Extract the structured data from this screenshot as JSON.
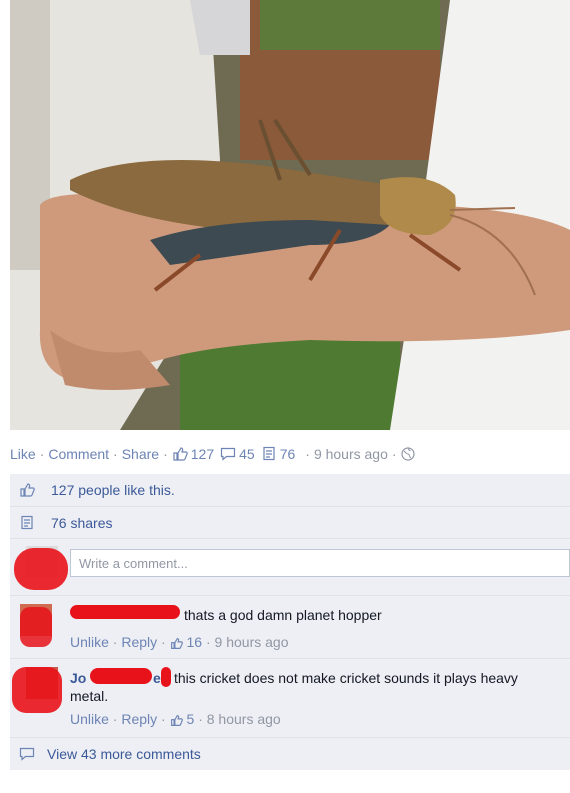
{
  "post": {
    "actions": {
      "like": "Like",
      "comment": "Comment",
      "share": "Share",
      "sep": "·"
    },
    "counts": {
      "likes": "127",
      "comments": "45",
      "shares": "76"
    },
    "time": "9 hours ago",
    "likes_summary": "127 people like this.",
    "shares_summary": "76 shares"
  },
  "composer": {
    "placeholder": "Write a comment..."
  },
  "comments": [
    {
      "name": "",
      "text": "thats a god damn planet hopper",
      "unlike": "Unlike",
      "reply": "Reply",
      "likes": "16",
      "time": "9 hours ago"
    },
    {
      "name": "Jo",
      "name_tail": "e",
      "text": "this cricket does not make cricket sounds it plays heavy",
      "text2": "metal.",
      "unlike": "Unlike",
      "reply": "Reply",
      "likes": "5",
      "time": "8 hours ago"
    }
  ],
  "more_comments": "View 43 more comments",
  "icons": [
    "thumbs-up-icon",
    "comment-icon",
    "share-icon",
    "globe-icon"
  ],
  "colors": {
    "link": "#3b5998",
    "meta": "#9197a3",
    "panel": "#edeff4",
    "redact": "#e8121a"
  }
}
